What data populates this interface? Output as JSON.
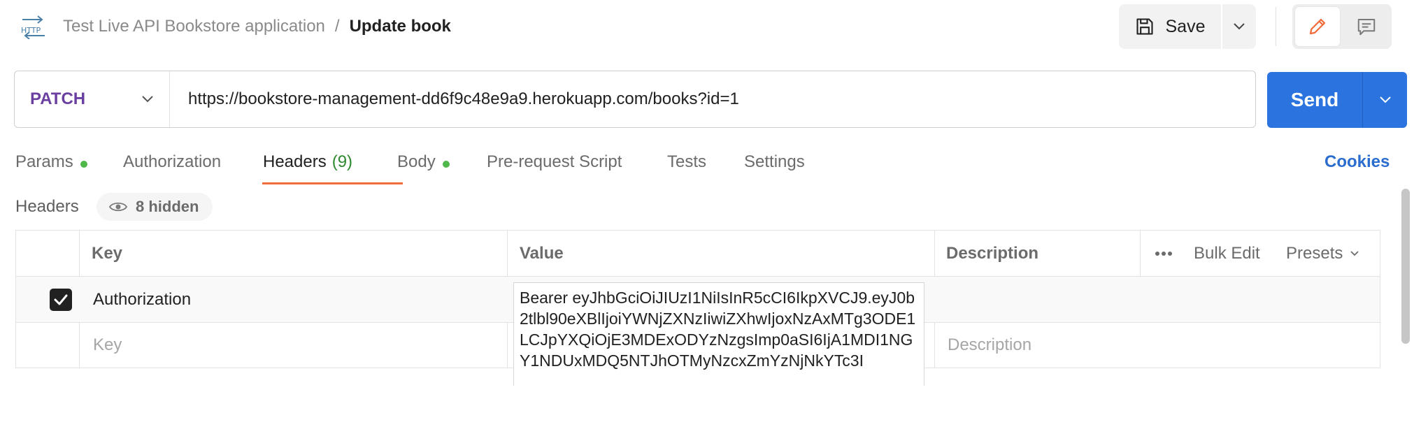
{
  "header": {
    "icon": "http-icon",
    "breadcrumb_parent": "Test Live API Bookstore application",
    "breadcrumb_separator": "/",
    "breadcrumb_current": "Update book",
    "save_label": "Save"
  },
  "request": {
    "method": "PATCH",
    "url": "https://bookstore-management-dd6f9c48e9a9.herokuapp.com/books?id=1",
    "send_label": "Send"
  },
  "tabs": {
    "params": "Params",
    "authorization": "Authorization",
    "headers": "Headers",
    "headers_count": "(9)",
    "body": "Body",
    "pre_request": "Pre-request Script",
    "tests": "Tests",
    "settings": "Settings",
    "cookies": "Cookies"
  },
  "headers_section": {
    "title": "Headers",
    "hidden_label": "8 hidden",
    "columns": {
      "key": "Key",
      "value": "Value",
      "description": "Description",
      "bulk_edit": "Bulk Edit",
      "presets": "Presets"
    },
    "rows": [
      {
        "checked": true,
        "key": "Authorization",
        "value": "Bearer eyJhbGciOiJIUzI1NiIsInR5cCI6IkpXVCJ9.eyJ0b2tlbl90eXBlIjoiYWNjZXNzIiwiZXhwIjoxNzAxMTg3ODE1LCJpYXQiOjE3MDExODYzNzgsImp0aSI6IjA1MDI1NGY1NDUxMDQ5NTJhOTMyNzcxZmYzNjNkYTc3I"
      }
    ],
    "new_row": {
      "key_placeholder": "Key",
      "description_placeholder": "Description"
    }
  },
  "colors": {
    "method": "#6b3fa0",
    "send": "#2b74e0",
    "active_tab_underline": "#f26b3a",
    "status_dot": "#4fb84a",
    "cookies_link": "#2b6ccf"
  }
}
